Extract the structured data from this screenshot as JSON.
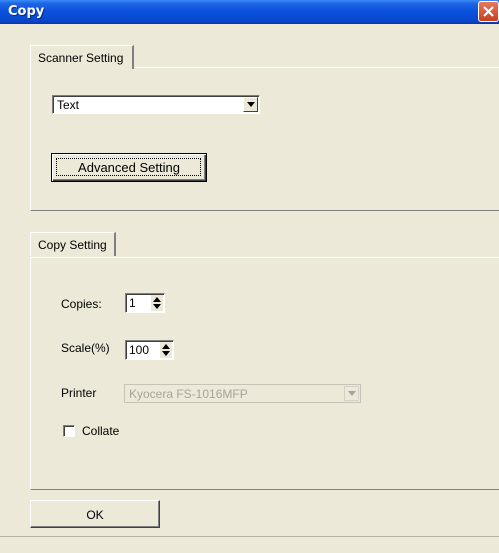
{
  "window": {
    "title": "Copy"
  },
  "scanner": {
    "tab_label": "Scanner Setting",
    "mode_value": "Text",
    "advanced_button": "Advanced Setting"
  },
  "copy": {
    "tab_label": "Copy Setting",
    "copies_label": "Copies:",
    "copies_value": "1",
    "scale_label": "Scale(%)",
    "scale_value": "100",
    "printer_label": "Printer",
    "printer_value": "Kyocera FS-1016MFP",
    "collate_label": "Collate",
    "collate_checked": false
  },
  "footer": {
    "ok_label": "OK"
  },
  "colors": {
    "titlebar": "#0a52dc",
    "face": "#ece9d8",
    "close": "#d5512c"
  },
  "icons": [
    "close-icon",
    "dropdown-arrow-icon",
    "spin-updown-icon"
  ]
}
